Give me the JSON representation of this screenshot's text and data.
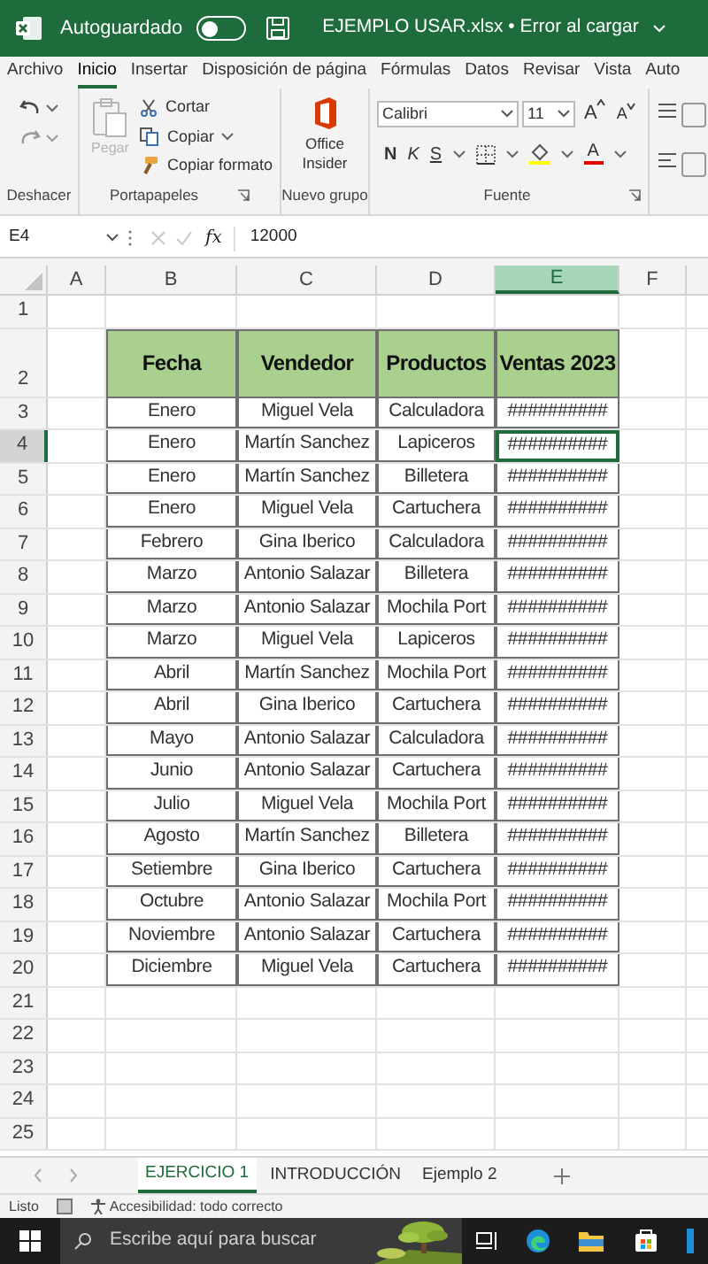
{
  "title_bar": {
    "autosave_label": "Autoguardado",
    "autosave_on": false,
    "file_title": "EJEMPLO USAR.xlsx • Error al cargar"
  },
  "menu_tabs": [
    {
      "label": "Archivo",
      "selected": false
    },
    {
      "label": "Inicio",
      "selected": true
    },
    {
      "label": "Insertar",
      "selected": false
    },
    {
      "label": "Disposición de página",
      "selected": false
    },
    {
      "label": "Fórmulas",
      "selected": false
    },
    {
      "label": "Datos",
      "selected": false
    },
    {
      "label": "Revisar",
      "selected": false
    },
    {
      "label": "Vista",
      "selected": false
    },
    {
      "label": "Auto",
      "selected": false
    }
  ],
  "ribbon": {
    "groups": [
      "Deshacer",
      "Portapapeles",
      "Nuevo grupo",
      "Fuente"
    ],
    "paste": {
      "label": "Pegar",
      "disabled": true
    },
    "cut": "Cortar",
    "copy": "Copiar",
    "format_painter": "Copiar formato",
    "office_insider": "Office Insider",
    "font": {
      "name": "Calibri",
      "size": "11",
      "grow": "A",
      "shrink": "A",
      "bold": "N",
      "italic": "K",
      "underline": "S",
      "font_color": "A"
    }
  },
  "formula_bar": {
    "name_box": "E4",
    "fx": "fx",
    "value": "12000"
  },
  "sheet": {
    "columns": [
      {
        "label": "A",
        "selected": false
      },
      {
        "label": "B",
        "selected": false
      },
      {
        "label": "C",
        "selected": false
      },
      {
        "label": "D",
        "selected": false
      },
      {
        "label": "E",
        "selected": true
      },
      {
        "label": "F",
        "selected": false
      }
    ],
    "rows": [
      {
        "label": "1",
        "selected": false
      },
      {
        "label": "2",
        "selected": false
      },
      {
        "label": "3",
        "selected": false
      },
      {
        "label": "4",
        "selected": true
      },
      {
        "label": "5",
        "selected": false
      },
      {
        "label": "6",
        "selected": false
      },
      {
        "label": "7",
        "selected": false
      },
      {
        "label": "8",
        "selected": false
      },
      {
        "label": "9",
        "selected": false
      },
      {
        "label": "10",
        "selected": false
      },
      {
        "label": "11",
        "selected": false
      },
      {
        "label": "12",
        "selected": false
      },
      {
        "label": "13",
        "selected": false
      },
      {
        "label": "14",
        "selected": false
      },
      {
        "label": "15",
        "selected": false
      },
      {
        "label": "16",
        "selected": false
      },
      {
        "label": "17",
        "selected": false
      },
      {
        "label": "18",
        "selected": false
      },
      {
        "label": "19",
        "selected": false
      },
      {
        "label": "20",
        "selected": false
      },
      {
        "label": "21",
        "selected": false
      },
      {
        "label": "22",
        "selected": false
      },
      {
        "label": "23",
        "selected": false
      },
      {
        "label": "24",
        "selected": false
      },
      {
        "label": "25",
        "selected": false
      }
    ],
    "table": {
      "columns": [
        "Fecha",
        "Vendedor",
        "Productos",
        "Ventas 2023"
      ],
      "rows": [
        [
          "Enero",
          "Miguel Vela",
          "Calculadora",
          "##########"
        ],
        [
          "Enero",
          "Martín Sanchez",
          "Lapiceros",
          "##########"
        ],
        [
          "Enero",
          "Martín Sanchez",
          "Billetera",
          "##########"
        ],
        [
          "Enero",
          "Miguel Vela",
          "Cartuchera",
          "##########"
        ],
        [
          "Febrero",
          "Gina Iberico",
          "Calculadora",
          "##########"
        ],
        [
          "Marzo",
          "Antonio Salazar",
          "Billetera",
          "##########"
        ],
        [
          "Marzo",
          "Antonio Salazar",
          "Mochila Port",
          "##########"
        ],
        [
          "Marzo",
          "Miguel Vela",
          "Lapiceros",
          "##########"
        ],
        [
          "Abril",
          "Martín Sanchez",
          "Mochila Port",
          "##########"
        ],
        [
          "Abril",
          "Gina Iberico",
          "Cartuchera",
          "##########"
        ],
        [
          "Mayo",
          "Antonio Salazar",
          "Calculadora",
          "##########"
        ],
        [
          "Junio",
          "Antonio Salazar",
          "Cartuchera",
          "##########"
        ],
        [
          "Julio",
          "Miguel Vela",
          "Mochila Port",
          "##########"
        ],
        [
          "Agosto",
          "Martín Sanchez",
          "Billetera",
          "##########"
        ],
        [
          "Setiembre",
          "Gina Iberico",
          "Cartuchera",
          "##########"
        ],
        [
          "Octubre",
          "Antonio Salazar",
          "Mochila Port",
          "##########"
        ],
        [
          "Noviembre",
          "Antonio Salazar",
          "Cartuchera",
          "##########"
        ],
        [
          "Diciembre",
          "Miguel Vela",
          "Cartuchera",
          "##########"
        ]
      ]
    }
  },
  "sheet_tabs": [
    {
      "label": "EJERCICIO 1",
      "selected": true
    },
    {
      "label": "INTRODUCCIÓN",
      "selected": false
    },
    {
      "label": "Ejemplo 2",
      "selected": false
    }
  ],
  "status_bar": {
    "ready": "Listo",
    "accessibility": "Accesibilidad: todo correcto"
  },
  "taskbar": {
    "search_placeholder": "Escribe aquí para buscar"
  }
}
